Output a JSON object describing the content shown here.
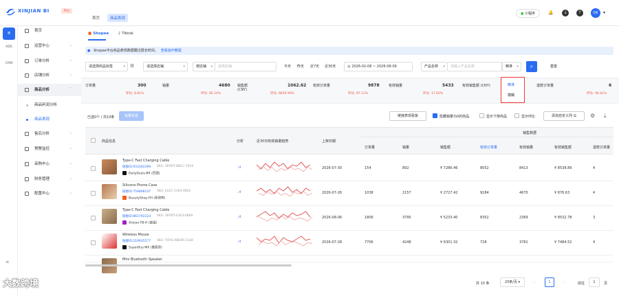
{
  "brand": {
    "name": "XINJIAN BI",
    "badge": "Pro"
  },
  "breadcrumbs": [
    "首页",
    "商品表现"
  ],
  "header": {
    "mini_program": "小程序",
    "avatar_text": "OK"
  },
  "rail": [
    "ADS",
    "CRM"
  ],
  "sidebar": {
    "items": [
      {
        "label": "首页"
      },
      {
        "label": "运营中心"
      },
      {
        "label": "订单分析"
      },
      {
        "label": "店铺分析"
      },
      {
        "label": "商品分析"
      },
      {
        "label": "售后分析"
      },
      {
        "label": "预警监控"
      },
      {
        "label": "采购中心"
      },
      {
        "label": "财务管理"
      },
      {
        "label": "配置中心"
      }
    ],
    "subitems": [
      {
        "label": "商品利润分析"
      },
      {
        "label": "商品表现"
      }
    ]
  },
  "tabs": [
    {
      "label": "Shopee"
    },
    {
      "label": "Tiktok"
    }
  ],
  "info": {
    "text": "Shopee平台商品表现数据跟过很长时间。",
    "link": "查看操作教程"
  },
  "filters": {
    "category": "请选择商品标签",
    "shop_type": "请选择店铺",
    "shop_select": "按店铺",
    "shop_placeholder": "选择店铺",
    "quick": [
      "今天",
      "昨天",
      "近7天",
      "近30天"
    ],
    "date_from": "2026-02-08",
    "date_sep": "~",
    "date_to": "2026-08-09",
    "product_field": "产品名称",
    "product_placeholder": "请输入产品名称",
    "match": "精准",
    "reset": "重置"
  },
  "metrics": [
    {
      "label": "订单量",
      "value": "300",
      "change": "环比: 8.81%"
    },
    {
      "label": "销量",
      "value": "4680",
      "change": "环比: 85.24%"
    },
    {
      "label": "销售额 (CNY)",
      "value": "1062.62",
      "change": "环比: 8839.90%"
    },
    {
      "label": "有效订单量",
      "value": "9878",
      "change": "环比: 87.11%"
    },
    {
      "label": "有效销量",
      "value": "5433",
      "change": "环比: 17.60%"
    },
    {
      "label": "有效销售额 (CNY)",
      "value": "",
      "change": ""
    },
    {
      "label": "退款订单量",
      "value": "6",
      "change": "环比: 96.81%"
    }
  ],
  "match_popup": [
    "精准",
    "模糊"
  ],
  "toolbar": {
    "selected": "已选0个 / 共10条",
    "batch_btn": "批量标签",
    "link_btn": "链接表现看板",
    "check_hide_zero": "隐藏销量为0的商品",
    "check_show_sales": "显示下架商品",
    "check_show_ratio": "显示环比",
    "custom_cols": "添加自定义列"
  },
  "table": {
    "headers": {
      "product": "商品信息",
      "analysis": "分析",
      "trend": "近30日有效销量趋势",
      "listing_date": "上架日期",
      "sales_group": "销售数据",
      "cols": [
        "订单量",
        "销量",
        "销售额",
        "有效订单量",
        "有效销量",
        "有效销售额",
        "退款订单量"
      ]
    },
    "id_label": "链接ID:",
    "sku_label": "SKU:",
    "rows": [
      {
        "name": "Type-C Fast Charging Cable",
        "id": "933362299",
        "sku": "SPORT-DBLC-7019",
        "shop": "DailyDeals-BR",
        "region": "(巴西)",
        "platform": "tk",
        "date": "2026-07-30",
        "orders": "154",
        "qty": "892",
        "amount": "¥ 7286.46",
        "v_orders": "8052",
        "v_qty": "8413",
        "v_amount": "¥ 8538.89",
        "refund": "4"
      },
      {
        "name": "Silicone Phone Case",
        "id": "759898147",
        "sku": "ELEC-1393-4601",
        "shop": "BeautyShop-PH",
        "region": "(菲律宾)",
        "platform": "sp",
        "date": "2026-07-26",
        "orders": "1038",
        "qty": "2157",
        "amount": "¥ 2727.42",
        "v_orders": "9184",
        "v_qty": "4670",
        "v_amount": "¥ 876.63",
        "refund": "4"
      },
      {
        "name": "Type-C Fast Charging Cable",
        "id": "861792224",
        "sku": "SPORT-E3E4-6869",
        "shop": "Xinjian-TB-H",
        "region": "(泰国)",
        "platform": "tb",
        "date": "2026-08-06",
        "orders": "1806",
        "qty": "3795",
        "amount": "¥ 5233.40",
        "v_orders": "8352",
        "v_qty": "2369",
        "v_amount": "¥ 8532.78",
        "refund": "3"
      },
      {
        "name": "Wireless Mouse",
        "id": "219935577",
        "sku": "TOYS-A8E6R-1148",
        "shop": "SuperBuy-MX",
        "region": "(墨西哥)",
        "platform": "tk",
        "date": "2026-07-28",
        "orders": "7706",
        "qty": "4248",
        "amount": "¥ 6301.32",
        "v_orders": "728",
        "v_qty": "3781",
        "v_amount": "¥ 7484.52",
        "refund": "4"
      },
      {
        "name": "Mini Bluetooth Speaker",
        "id": "",
        "sku": "",
        "shop": "",
        "region": "",
        "platform": "",
        "date": "",
        "orders": "",
        "qty": "",
        "amount": "",
        "v_orders": "",
        "v_qty": "",
        "v_amount": "",
        "refund": ""
      }
    ]
  },
  "pagination": {
    "total": "共 10 条",
    "per_page": "20条/页",
    "current": "1",
    "goto_label": "前往",
    "goto_value": "1",
    "page_suffix": "页"
  },
  "watermark": "大数跨境",
  "colors": {
    "accent": "#2a6cf2",
    "danger": "#e54444",
    "trend": "#e05a5a"
  }
}
